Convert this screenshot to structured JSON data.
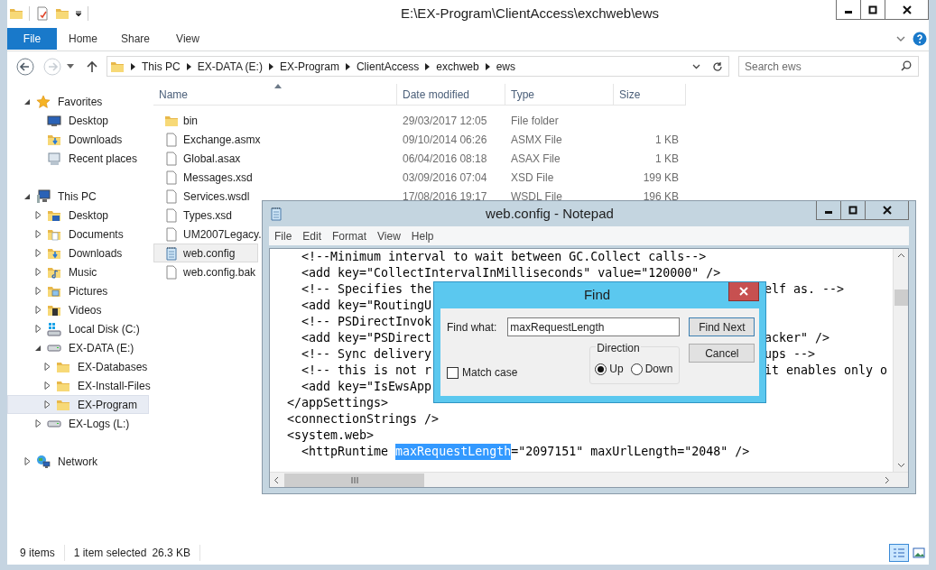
{
  "explorer": {
    "title": "E:\\EX-Program\\ClientAccess\\exchweb\\ews",
    "ribbon_tabs": [
      {
        "label": "File",
        "selected": true
      },
      {
        "label": "Home",
        "selected": false
      },
      {
        "label": "Share",
        "selected": false
      },
      {
        "label": "View",
        "selected": false
      }
    ],
    "address": [
      "This PC",
      "EX-DATA (E:)",
      "EX-Program",
      "ClientAccess",
      "exchweb",
      "ews"
    ],
    "search": {
      "placeholder": "Search ews"
    },
    "nav": [
      {
        "label": "Favorites",
        "kind": "star",
        "expanded": true,
        "selected": false,
        "children": [
          {
            "label": "Desktop",
            "kind": "desktop",
            "selected": false
          },
          {
            "label": "Downloads",
            "kind": "downloads",
            "selected": false
          },
          {
            "label": "Recent places",
            "kind": "recent",
            "selected": false
          }
        ]
      },
      {
        "label": "This PC",
        "kind": "pc",
        "expanded": true,
        "selected": false,
        "children": [
          {
            "label": "Desktop",
            "kind": "desktop-folder",
            "expanded": false,
            "selected": false
          },
          {
            "label": "Documents",
            "kind": "documents",
            "expanded": false,
            "selected": false
          },
          {
            "label": "Downloads",
            "kind": "downloads",
            "expanded": false,
            "selected": false
          },
          {
            "label": "Music",
            "kind": "music",
            "expanded": false,
            "selected": false
          },
          {
            "label": "Pictures",
            "kind": "pictures",
            "expanded": false,
            "selected": false
          },
          {
            "label": "Videos",
            "kind": "videos",
            "expanded": false,
            "selected": false
          },
          {
            "label": "Local Disk (C:)",
            "kind": "windisk",
            "expanded": false,
            "selected": false
          },
          {
            "label": "EX-DATA (E:)",
            "kind": "drive",
            "expanded": true,
            "selected": false,
            "children": [
              {
                "label": "EX-Databases",
                "kind": "folder",
                "expanded": false,
                "selected": false
              },
              {
                "label": "EX-Install-Files",
                "kind": "folder",
                "expanded": false,
                "selected": false
              },
              {
                "label": "EX-Program",
                "kind": "folder",
                "expanded": false,
                "selected": true
              }
            ]
          },
          {
            "label": "EX-Logs (L:)",
            "kind": "drive",
            "expanded": false,
            "selected": false
          }
        ]
      },
      {
        "label": "Network",
        "kind": "network",
        "expanded": false,
        "selected": false
      }
    ],
    "columns": [
      "Name",
      "Date modified",
      "Type",
      "Size"
    ],
    "files": [
      {
        "name": "bin",
        "kind": "folder",
        "date": "29/03/2017 12:05",
        "type": "File folder",
        "selected": false
      },
      {
        "name": "Exchange.asmx",
        "kind": "file",
        "date": "09/10/2014 06:26",
        "type": "ASMX File",
        "size": "1 KB",
        "selected": false
      },
      {
        "name": "Global.asax",
        "kind": "file",
        "date": "06/04/2016 08:18",
        "type": "ASAX File",
        "size": "1 KB",
        "selected": false
      },
      {
        "name": "Messages.xsd",
        "kind": "file",
        "date": "03/09/2016 07:04",
        "type": "XSD File",
        "size": "199 KB",
        "selected": false
      },
      {
        "name": "Services.wsdl",
        "kind": "file",
        "date": "17/08/2016 19:17",
        "type": "WSDL File",
        "size": "196 KB",
        "selected": false
      },
      {
        "name": "Types.xsd",
        "kind": "file",
        "selected": false
      },
      {
        "name": "UM2007Legacy.",
        "kind": "file",
        "selected": false
      },
      {
        "name": "web.config",
        "kind": "notepad",
        "selected": true
      },
      {
        "name": "web.config.bak",
        "kind": "file",
        "selected": false
      }
    ],
    "status": {
      "items": "9 items",
      "selection": "1 item selected",
      "size": "26.3 KB",
      "views": [
        {
          "kind": "details",
          "selected": true
        },
        {
          "kind": "tiles",
          "selected": false
        }
      ]
    }
  },
  "notepad": {
    "title": "web.config - Notepad",
    "menu": [
      "File",
      "Edit",
      "Format",
      "View",
      "Help"
    ],
    "lines": [
      {
        "parts": [
          {
            "text": "    <!--Minimum interval to wait between GC.Collect calls-->",
            "selected": false
          }
        ]
      },
      {
        "parts": [
          {
            "text": "    <add key=\"CollectIntervalInMilliseconds\" value=\"120000\" />",
            "selected": false
          }
        ]
      },
      {
        "parts": [
          {
            "text": "    <!-- Specifies the",
            "selected": false
          }
        ],
        "right": "elf as. -->"
      },
      {
        "parts": [
          {
            "text": "    <add key=\"RoutingU",
            "selected": false
          }
        ]
      },
      {
        "parts": [
          {
            "text": "    <!-- PSDirectInvok",
            "selected": false
          }
        ]
      },
      {
        "parts": [
          {
            "text": "    <add key=\"PSDirect",
            "selected": false
          }
        ],
        "right": "acker\" />"
      },
      {
        "parts": [
          {
            "text": "    <!-- Sync delivery",
            "selected": false
          }
        ],
        "right": "ups -->"
      },
      {
        "parts": [
          {
            "text": "    <!-- this is not r",
            "selected": false
          }
        ],
        "right": "it enables only o"
      },
      {
        "parts": [
          {
            "text": "    <add key=\"IsEwsApp",
            "selected": false
          }
        ]
      },
      {
        "parts": [
          {
            "text": "  </appSettings>",
            "selected": false
          }
        ]
      },
      {
        "parts": [
          {
            "text": "  <connectionStrings />",
            "selected": false
          }
        ]
      },
      {
        "parts": [
          {
            "text": "  <system.web>",
            "selected": false
          }
        ]
      },
      {
        "parts": [
          {
            "text": "    <httpRuntime ",
            "selected": false
          },
          {
            "text": "maxRequestLength",
            "selected": true
          },
          {
            "text": "=\"2097151\" maxUrlLength=\"2048\" />",
            "selected": false
          }
        ]
      }
    ]
  },
  "find": {
    "title": "Find",
    "label": "Find what:",
    "value": "maxRequestLength",
    "buttons": [
      "Find Next",
      "Cancel"
    ],
    "match_case": {
      "label": "Match case",
      "checked": false
    },
    "direction": {
      "label": "Direction",
      "options": [
        {
          "label": "Up",
          "selected": true
        },
        {
          "label": "Down",
          "selected": false
        }
      ]
    }
  }
}
